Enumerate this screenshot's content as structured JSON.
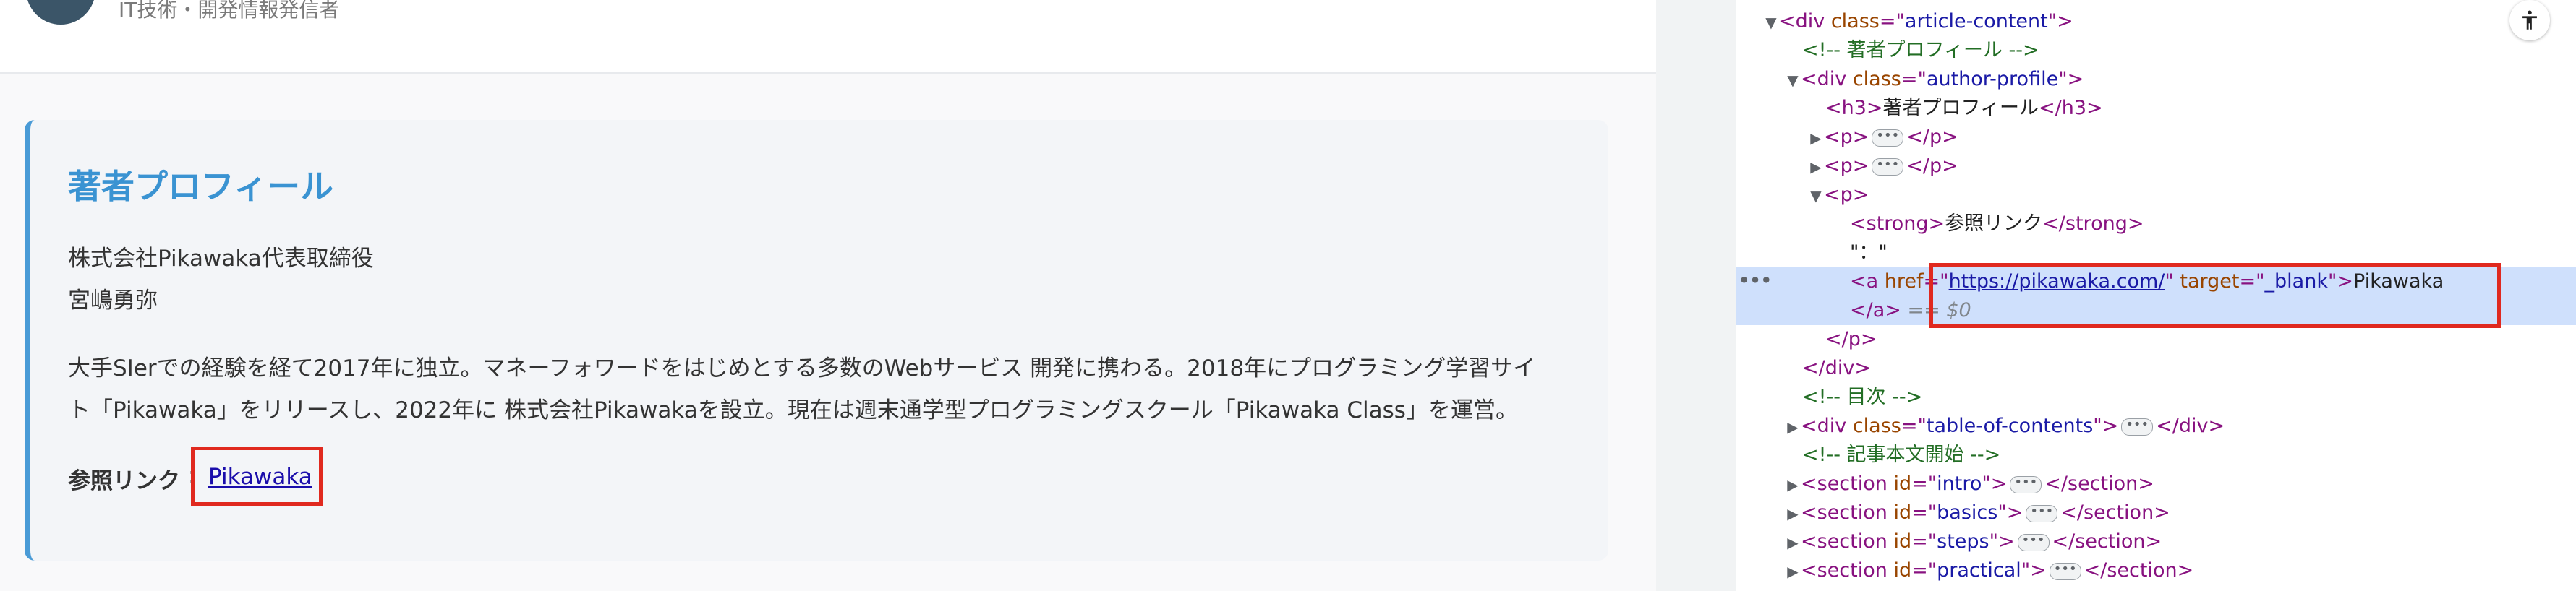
{
  "page": {
    "author_subtitle": "IT技術・開発情報発信者",
    "profile": {
      "title": "著者プロフィール",
      "company": "株式会社Pikawaka代表取締役",
      "name": "宮嶋勇弥",
      "bio_line_1": "大手SIerでの経験を経て2017年に独立。マネーフォワードをはじめとする多数のWebサービス 開発に携わる。2018年にプログラミング学習サイ",
      "bio_line_2": "ト「Pikawaka」をリリースし、2022年に 株式会社Pikawakaを設立。現在は週末通学型プログラミングスクール「Pikawaka Class」を運営。",
      "ref_label": "参照リンク",
      "ref_colon": ":",
      "ref_link": "Pikawaka"
    }
  },
  "devtools": {
    "row_dots": "•••",
    "nodes": {
      "n0": {
        "tag_open": "<div ",
        "attr": "class",
        "eq": "=\"",
        "val": "article-content",
        "close": "\">"
      },
      "n1": {
        "text": "<!-- 著者プロフィール -->"
      },
      "n2": {
        "tag_open": "<div ",
        "attr": "class",
        "eq": "=\"",
        "val": "author-profile",
        "close": "\">"
      },
      "n3": {
        "open": "<h3>",
        "text": "著者プロフィール",
        "close": "</h3>"
      },
      "n4": {
        "open": "<p>",
        "close": "</p>"
      },
      "n5": {
        "open": "<p>",
        "close": "</p>"
      },
      "n6": {
        "open": "<p>"
      },
      "n7": {
        "open": "<strong>",
        "text": "参照リンク",
        "close": "</strong>"
      },
      "n8": {
        "text": "\"：\""
      },
      "n9": {
        "tag_open": "<a ",
        "attr1": "href",
        "eq1": "=\"",
        "val1": "https://pikawaka.com/",
        "q1": "\" ",
        "attr2": "target",
        "eq2": "=\"",
        "val2": "_blank",
        "q2": "\">",
        "text": "Pikawaka"
      },
      "n10": {
        "close": "</a>",
        "dollar": "== $0"
      },
      "n11": {
        "close": "</p>"
      },
      "n12": {
        "close": "</div>"
      },
      "n13": {
        "text": "<!-- 目次 -->"
      },
      "n14": {
        "tag_open": "<div ",
        "attr": "class",
        "eq": "=\"",
        "val": "table-of-contents",
        "q": "\">",
        "close": "</div>"
      },
      "n15": {
        "text": "<!-- 記事本文開始 -->"
      },
      "n16": {
        "tag_open": "<section ",
        "attr": "id",
        "eq": "=\"",
        "val": "intro",
        "q": "\">",
        "close": "</section>"
      },
      "n17": {
        "tag_open": "<section ",
        "attr": "id",
        "eq": "=\"",
        "val": "basics",
        "q": "\">",
        "close": "</section>"
      },
      "n18": {
        "tag_open": "<section ",
        "attr": "id",
        "eq": "=\"",
        "val": "steps",
        "q": "\">",
        "close": "</section>"
      },
      "n19": {
        "tag_open": "<section ",
        "attr": "id",
        "eq": "=\"",
        "val": "practical",
        "q": "\">",
        "close": "</section>"
      }
    },
    "ellipsis": "•••"
  },
  "colors": {
    "accent_blue": "#3a93d2",
    "highlight_red": "#e0291f",
    "selected_row": "#cfe0fc"
  }
}
